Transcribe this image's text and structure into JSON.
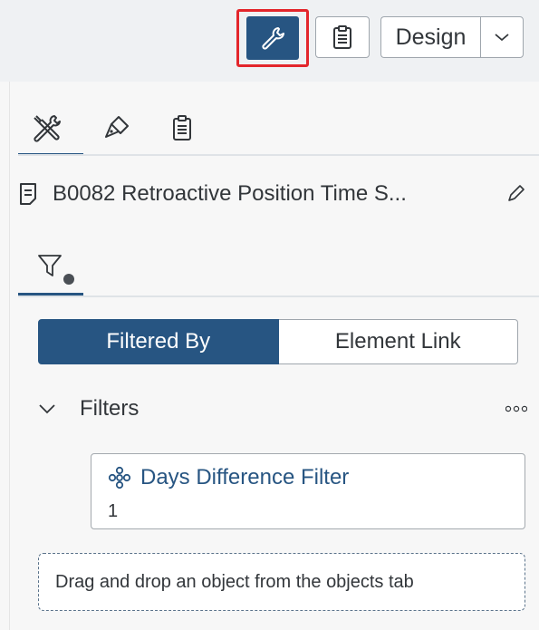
{
  "toolbar": {
    "design_label": "Design",
    "icons": [
      "wrench-icon",
      "clipboard-icon",
      "chevron-down-icon"
    ]
  },
  "icon_tabs": [
    "tools-icon",
    "paint-brush-icon",
    "clipboard-icon"
  ],
  "story": {
    "title": "B0082 Retroactive Position Time S...",
    "icons": [
      "document-icon",
      "pencil-icon"
    ]
  },
  "filter_tab": {
    "icon": "filter-icon",
    "has_dot": true
  },
  "segments": {
    "filtered_by": "Filtered By",
    "element_link": "Element Link",
    "active": "filtered_by"
  },
  "filters": {
    "heading": "Filters",
    "items": [
      {
        "name": "Days Difference Filter",
        "value": "1",
        "icon": "calculated-dimension-icon"
      }
    ]
  },
  "drop_zone": {
    "text": "Drag and drop an object from the objects tab"
  },
  "colors": {
    "accent": "#275582",
    "highlight": "#e3262b",
    "panel": "#f7f7f7",
    "topbar": "#eff1f3"
  }
}
